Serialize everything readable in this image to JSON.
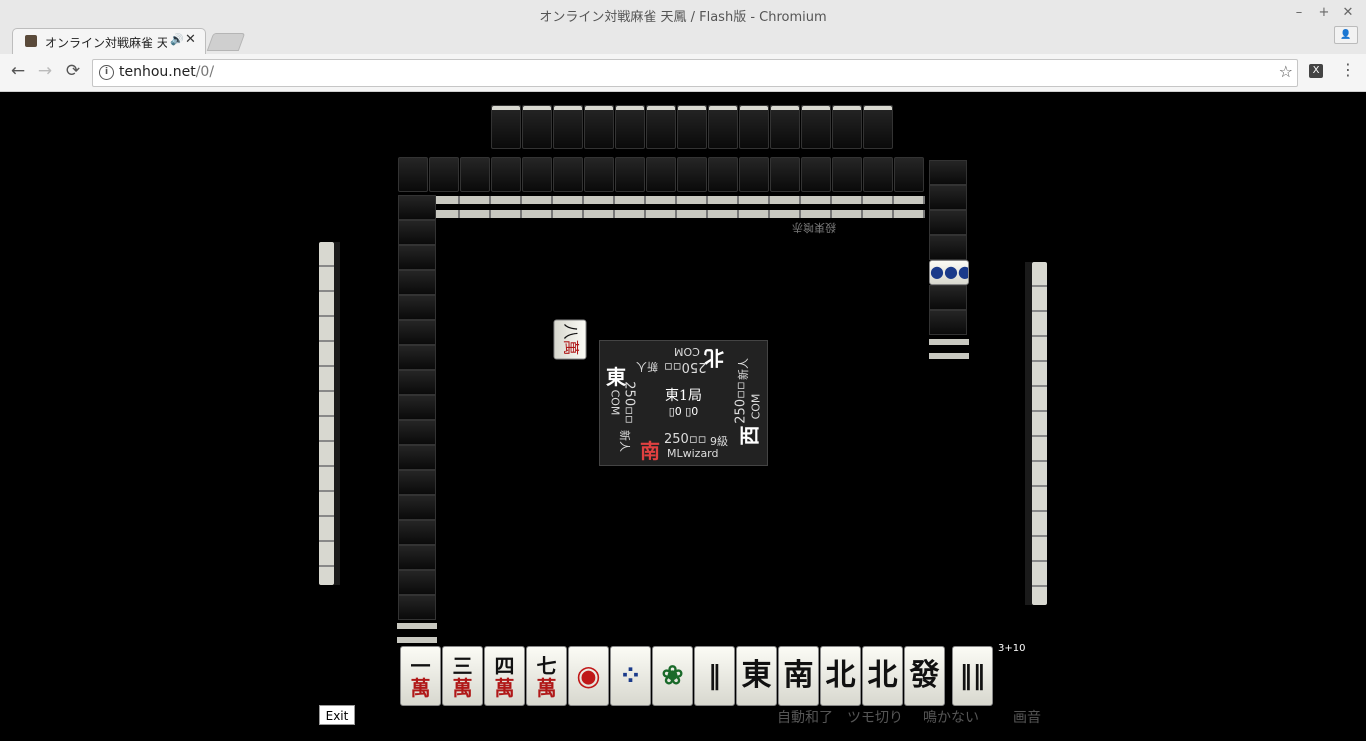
{
  "window": {
    "title": "オンライン対戦麻雀 天鳳 / Flash版 - Chromium",
    "controls": [
      "–",
      "+",
      "✕"
    ]
  },
  "tab": {
    "title": "オンライン対戦麻雀 天",
    "audio_icon": "🔊",
    "close": "✕"
  },
  "toolbar": {
    "back": "←",
    "forward": "→",
    "reload": "⟳",
    "url_host": "tenhou.net",
    "url_path": "/0/",
    "info": "i",
    "star": "☆",
    "menu": "⋮",
    "ext": "X"
  },
  "game": {
    "round": "東1局",
    "sticks": "▯0 ▯0",
    "players": {
      "self": {
        "wind": "南",
        "score": "250▫▫",
        "rank": "9級",
        "name": "MLwizard"
      },
      "left": {
        "wind": "東",
        "score": "250▫▫",
        "rank": "新人",
        "name": "COM"
      },
      "top": {
        "wind": "北",
        "score": "250▫▫",
        "rank": "新人",
        "name": "COM"
      },
      "right": {
        "wind": "西",
        "score": "250▫▫",
        "rank": "新人",
        "name": "COM"
      }
    },
    "opponent_label": "殺東喰赤",
    "discard": {
      "num": "八",
      "suit": "萬"
    },
    "dora": "●●●",
    "remaining": "3+10",
    "hand": [
      {
        "num": "一",
        "suit": "萬"
      },
      {
        "num": "三",
        "suit": "萬"
      },
      {
        "num": "四",
        "suit": "萬"
      },
      {
        "num": "七",
        "suit": "萬"
      },
      {
        "pin": "◉"
      },
      {
        "pin": "⁘"
      },
      {
        "bam": "❀"
      },
      {
        "bam": "‖"
      },
      {
        "honor": "東"
      },
      {
        "honor": "南"
      },
      {
        "honor": "北"
      },
      {
        "honor": "北"
      },
      {
        "honor": "發"
      }
    ],
    "drawn": {
      "bam": "‖‖"
    },
    "options": {
      "auto_win": "自動和了",
      "tsumogiri": "ツモ切り",
      "no_call": "鳴かない",
      "sound": "画音"
    },
    "exit": "Exit"
  }
}
